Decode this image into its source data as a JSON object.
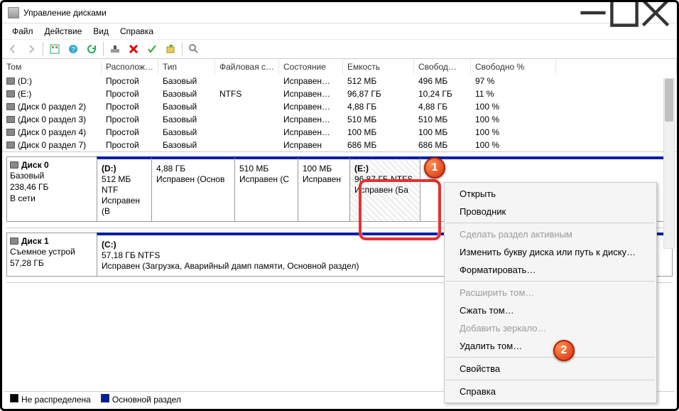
{
  "window": {
    "title": "Управление дисками"
  },
  "menu": {
    "file": "Файл",
    "action": "Действие",
    "view": "Вид",
    "help": "Справка"
  },
  "cols": {
    "volume": "Том",
    "layout": "Располож…",
    "type": "Тип",
    "fs": "Файловая с…",
    "status": "Состояние",
    "capacity": "Емкость",
    "free": "Свобод…",
    "freepct": "Свободно %"
  },
  "rows": [
    {
      "name": "(D:)",
      "layout": "Простой",
      "type": "Базовый",
      "fs": "",
      "status": "Исправен…",
      "cap": "512 МБ",
      "free": "496 МБ",
      "pct": "97 %"
    },
    {
      "name": "(E:)",
      "layout": "Простой",
      "type": "Базовый",
      "fs": "NTFS",
      "status": "Исправен…",
      "cap": "96,87 ГБ",
      "free": "10,24 ГБ",
      "pct": "11 %"
    },
    {
      "name": "(Диск 0 раздел 2)",
      "layout": "Простой",
      "type": "Базовый",
      "fs": "",
      "status": "Исправен…",
      "cap": "4,88 ГБ",
      "free": "4,88 ГБ",
      "pct": "100 %"
    },
    {
      "name": "(Диск 0 раздел 3)",
      "layout": "Простой",
      "type": "Базовый",
      "fs": "",
      "status": "Исправен…",
      "cap": "510 МБ",
      "free": "510 МБ",
      "pct": "100 %"
    },
    {
      "name": "(Диск 0 раздел 4)",
      "layout": "Простой",
      "type": "Базовый",
      "fs": "",
      "status": "Исправен…",
      "cap": "100 МБ",
      "free": "100 МБ",
      "pct": "100 %"
    },
    {
      "name": "(Диск 0 раздел 7)",
      "layout": "Простой",
      "type": "Базовый",
      "fs": "",
      "status": "Исправен",
      "cap": "686 МБ",
      "free": "686 МБ",
      "pct": "100 %"
    }
  ],
  "disk0": {
    "name": "Диск 0",
    "type": "Базовый",
    "size": "238,46 ГБ",
    "status": "В сети",
    "p1": {
      "name": "(D:)",
      "l1": "512 МБ NTF",
      "l2": "Исправен (B"
    },
    "p2": {
      "name": "",
      "l1": "4,88 ГБ",
      "l2": "Исправен (Основ"
    },
    "p3": {
      "name": "",
      "l1": "510 МБ",
      "l2": "Исправен (С"
    },
    "p4": {
      "name": "",
      "l1": "100 МБ",
      "l2": "Исправен"
    },
    "p5": {
      "name": "(E:)",
      "l1": "96,87 ГБ NTFS",
      "l2": "Исправен (Ба"
    }
  },
  "disk1": {
    "name": "Диск 1",
    "type": "Съемное устрой",
    "size": "57,28 ГБ",
    "status": "",
    "p1": {
      "name": "(C:)",
      "l1": "57,18 ГБ NTFS",
      "l2": "Исправен (Загрузка, Аварийный дамп памяти, Основной раздел)"
    }
  },
  "legend": {
    "unalloc": "Не распределена",
    "primary": "Основной раздел"
  },
  "ctx": {
    "open": "Открыть",
    "explorer": "Проводник",
    "active": "Сделать раздел активным",
    "letter": "Изменить букву диска или путь к диску…",
    "format": "Форматировать…",
    "extend": "Расширить том…",
    "shrink": "Сжать том…",
    "mirror": "Добавить зеркало…",
    "delete": "Удалить том…",
    "props": "Свойства",
    "help": "Справка"
  },
  "badges": {
    "b1": "1",
    "b2": "2"
  }
}
